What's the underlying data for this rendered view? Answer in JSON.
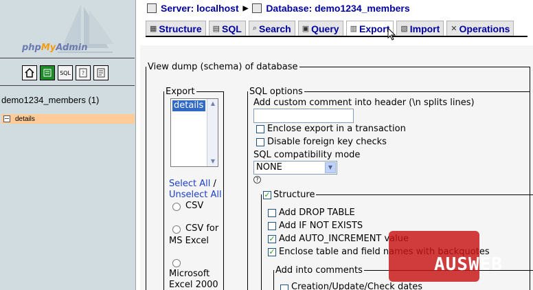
{
  "left_panel": {
    "logo": {
      "php": "php",
      "my": "My",
      "admin": "Admin"
    },
    "icons": [
      "home-icon",
      "query-icon",
      "sql-icon",
      "docs-icon",
      "changelog-icon"
    ],
    "db_name": "demo1234_members (1)",
    "tables": [
      {
        "label": "details"
      }
    ]
  },
  "header": {
    "server_label": "Server: localhost",
    "database_label": "Database: demo1234_members"
  },
  "tabs": [
    {
      "label": "Structure",
      "icon": "structure-icon"
    },
    {
      "label": "SQL",
      "icon": "sql-icon"
    },
    {
      "label": "Search",
      "icon": "search-icon"
    },
    {
      "label": "Query",
      "icon": "query-icon"
    },
    {
      "label": "Export",
      "icon": "export-icon",
      "active": true
    },
    {
      "label": "Import",
      "icon": "import-icon"
    },
    {
      "label": "Operations",
      "icon": "operations-icon"
    }
  ],
  "dump": {
    "legend": "View dump (schema) of database",
    "export": {
      "legend": "Export",
      "list_selected": "details",
      "select_all": "Select All",
      "slash": " /",
      "unselect_all": "Unselect All",
      "formats": [
        {
          "label": "CSV"
        },
        {
          "label_line1": "CSV for",
          "label_line2": "MS Excel"
        },
        {
          "label_line1": "Microsoft",
          "label_line2": "Excel 2000"
        }
      ]
    },
    "sql_options": {
      "legend": "SQL options",
      "comment_label": "Add custom comment into header (\\n splits lines)",
      "comment_value": "",
      "enclose_transaction": "Enclose export in a transaction",
      "disable_fk": "Disable foreign key checks",
      "compat_label": "SQL compatibility mode",
      "compat_value": "NONE",
      "structure": {
        "legend": "Structure",
        "checked": true,
        "options": [
          {
            "label": "Add DROP TABLE",
            "checked": false
          },
          {
            "label": "Add IF NOT EXISTS",
            "checked": false
          },
          {
            "label": "Add AUTO_INCREMENT value",
            "checked": true
          },
          {
            "label": "Enclose table and field names with backquotes",
            "checked": true
          }
        ],
        "comments": {
          "legend": "Add into comments",
          "option": "Creation/Update/Check dates"
        }
      }
    }
  },
  "watermark": "AUSWEB"
}
